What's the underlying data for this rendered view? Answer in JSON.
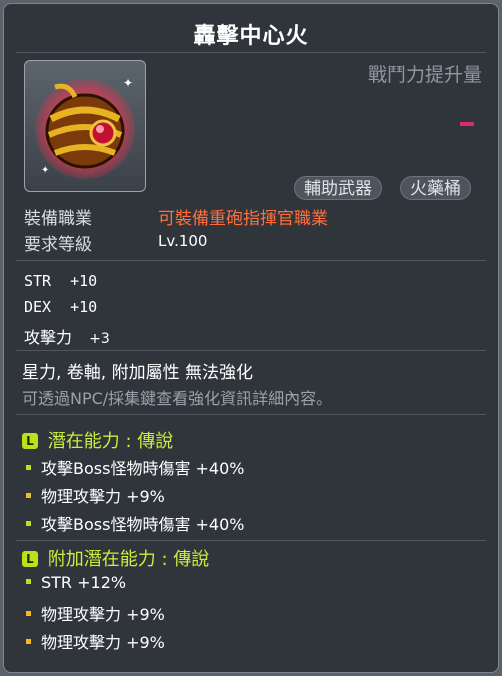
{
  "item": {
    "name": "轟擊中心火",
    "power_label": "戰鬥力提升量",
    "tags": [
      "輔助武器",
      "火藥桶"
    ]
  },
  "requirements": {
    "job_label": "裝備職業",
    "job_value": "可裝備重砲指揮官職業",
    "level_label": "要求等級",
    "level_value": "Lv.100"
  },
  "stats": [
    {
      "name": "STR",
      "value": "+10"
    },
    {
      "name": "DEX",
      "value": "+10"
    },
    {
      "name": "攻擊力",
      "value": "+3"
    }
  ],
  "notes": {
    "no_enhance": "星力, 卷軸, 附加屬性 無法強化",
    "hint": "可透過NPC/採集鍵查看強化資訊詳細內容。"
  },
  "potential": {
    "grade_letter": "L",
    "title": "潛在能力 : 傳說",
    "lines": [
      {
        "text": "攻擊Boss怪物時傷害 +40%",
        "color": "#b7e318"
      },
      {
        "text": "物理攻擊力 +9%",
        "color": "#f3bb1c"
      },
      {
        "text": "攻擊Boss怪物時傷害 +40%",
        "color": "#b7e318"
      }
    ]
  },
  "additional_potential": {
    "grade_letter": "L",
    "title": "附加潛在能力 : 傳說",
    "lines": [
      {
        "text": "STR +12%",
        "color": "#b7e318"
      },
      {
        "text": "物理攻擊力 +9%",
        "color": "#f3bb1c"
      },
      {
        "text": "物理攻擊力 +9%",
        "color": "#f3bb1c"
      }
    ]
  }
}
